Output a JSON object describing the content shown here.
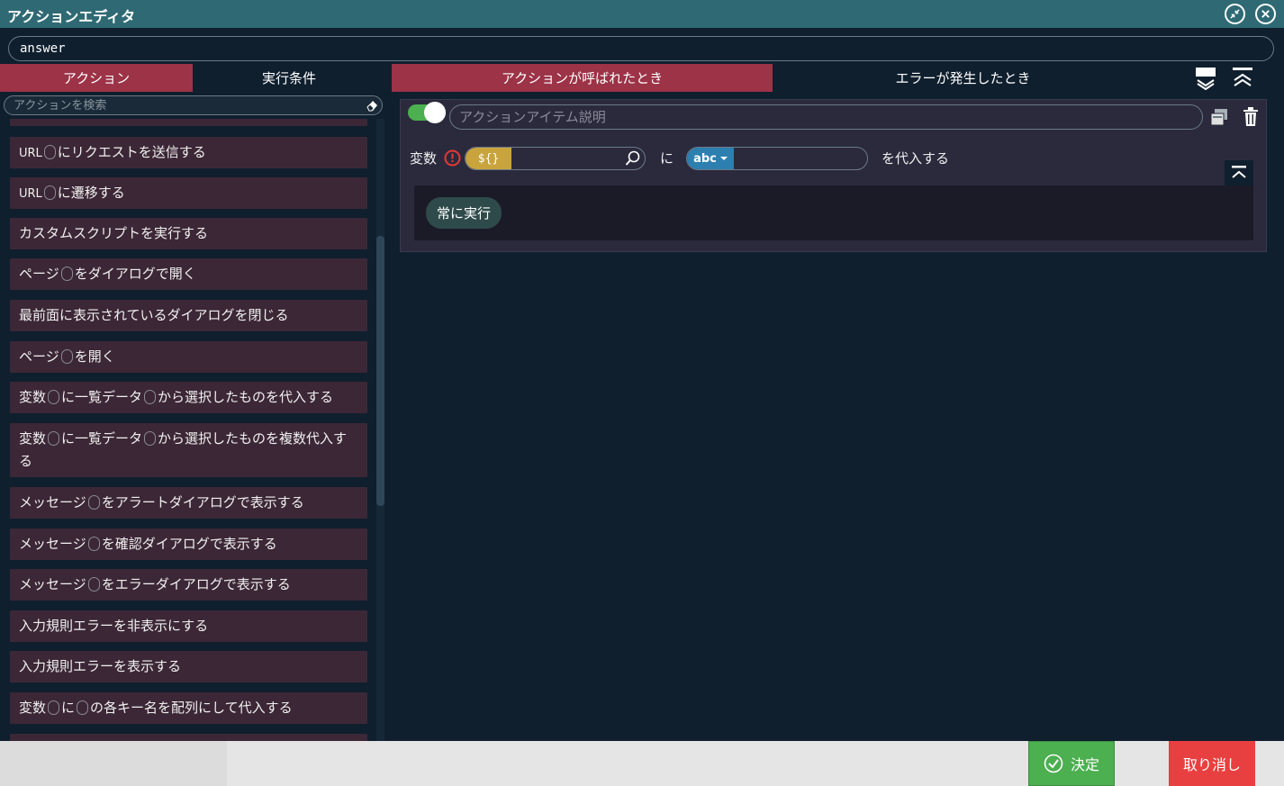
{
  "window": {
    "title": "アクションエディタ",
    "restore_icon": "compress-icon",
    "close_icon": "close-icon"
  },
  "action_name": "answer",
  "left_panel": {
    "tabs": [
      {
        "label": "アクション",
        "active": true
      },
      {
        "label": "実行条件",
        "active": false
      }
    ],
    "search_placeholder": "アクションを検索",
    "items": [
      {
        "parts": [
          "URL",
          "slot",
          "にリクエストを送信する"
        ]
      },
      {
        "parts": [
          "URL",
          "slot",
          "に遷移する"
        ]
      },
      {
        "parts": [
          "カスタムスクリプトを実行する"
        ]
      },
      {
        "parts": [
          "ページ",
          "slot",
          "をダイアログで開く"
        ]
      },
      {
        "parts": [
          "最前面に表示されているダイアログを閉じる"
        ]
      },
      {
        "parts": [
          "ページ",
          "slot",
          "を開く"
        ]
      },
      {
        "parts": [
          "変数",
          "slot",
          "に一覧データ",
          "slot",
          "から選択したものを代入する"
        ]
      },
      {
        "parts": [
          "変数",
          "slot",
          "に一覧データ",
          "slot",
          "から選択したものを複数代入する"
        ]
      },
      {
        "parts": [
          "メッセージ",
          "slot",
          "をアラートダイアログで表示する"
        ]
      },
      {
        "parts": [
          "メッセージ",
          "slot",
          "を確認ダイアログで表示する"
        ]
      },
      {
        "parts": [
          "メッセージ",
          "slot",
          "をエラーダイアログで表示する"
        ]
      },
      {
        "parts": [
          "入力規則エラーを非表示にする"
        ]
      },
      {
        "parts": [
          "入力規則エラーを表示する"
        ]
      },
      {
        "parts": [
          "変数",
          "slot",
          "に",
          "slot",
          "の各キー名を配列にして代入する"
        ]
      }
    ]
  },
  "right_panel": {
    "tabs": [
      {
        "label": "アクションが呼ばれたとき",
        "active": true
      },
      {
        "label": "エラーが発生したとき",
        "active": false
      }
    ],
    "action_item": {
      "enabled": true,
      "description_placeholder": "アクションアイテム説明",
      "variable_label": "変数",
      "variable_badge": "${}",
      "connector": "に",
      "value_badge": "abc",
      "suffix": "を代入する",
      "condition_chip": "常に実行"
    }
  },
  "footer": {
    "ok_label": "決定",
    "cancel_label": "取り消し"
  },
  "colors": {
    "title_bar": "#2f6a74",
    "active_tab": "#9c3347",
    "list_item": "#3c2736",
    "ok": "#4caf50",
    "cancel": "#e84040",
    "variable_badge": "#c9a43c",
    "value_badge": "#2d7fb0"
  }
}
